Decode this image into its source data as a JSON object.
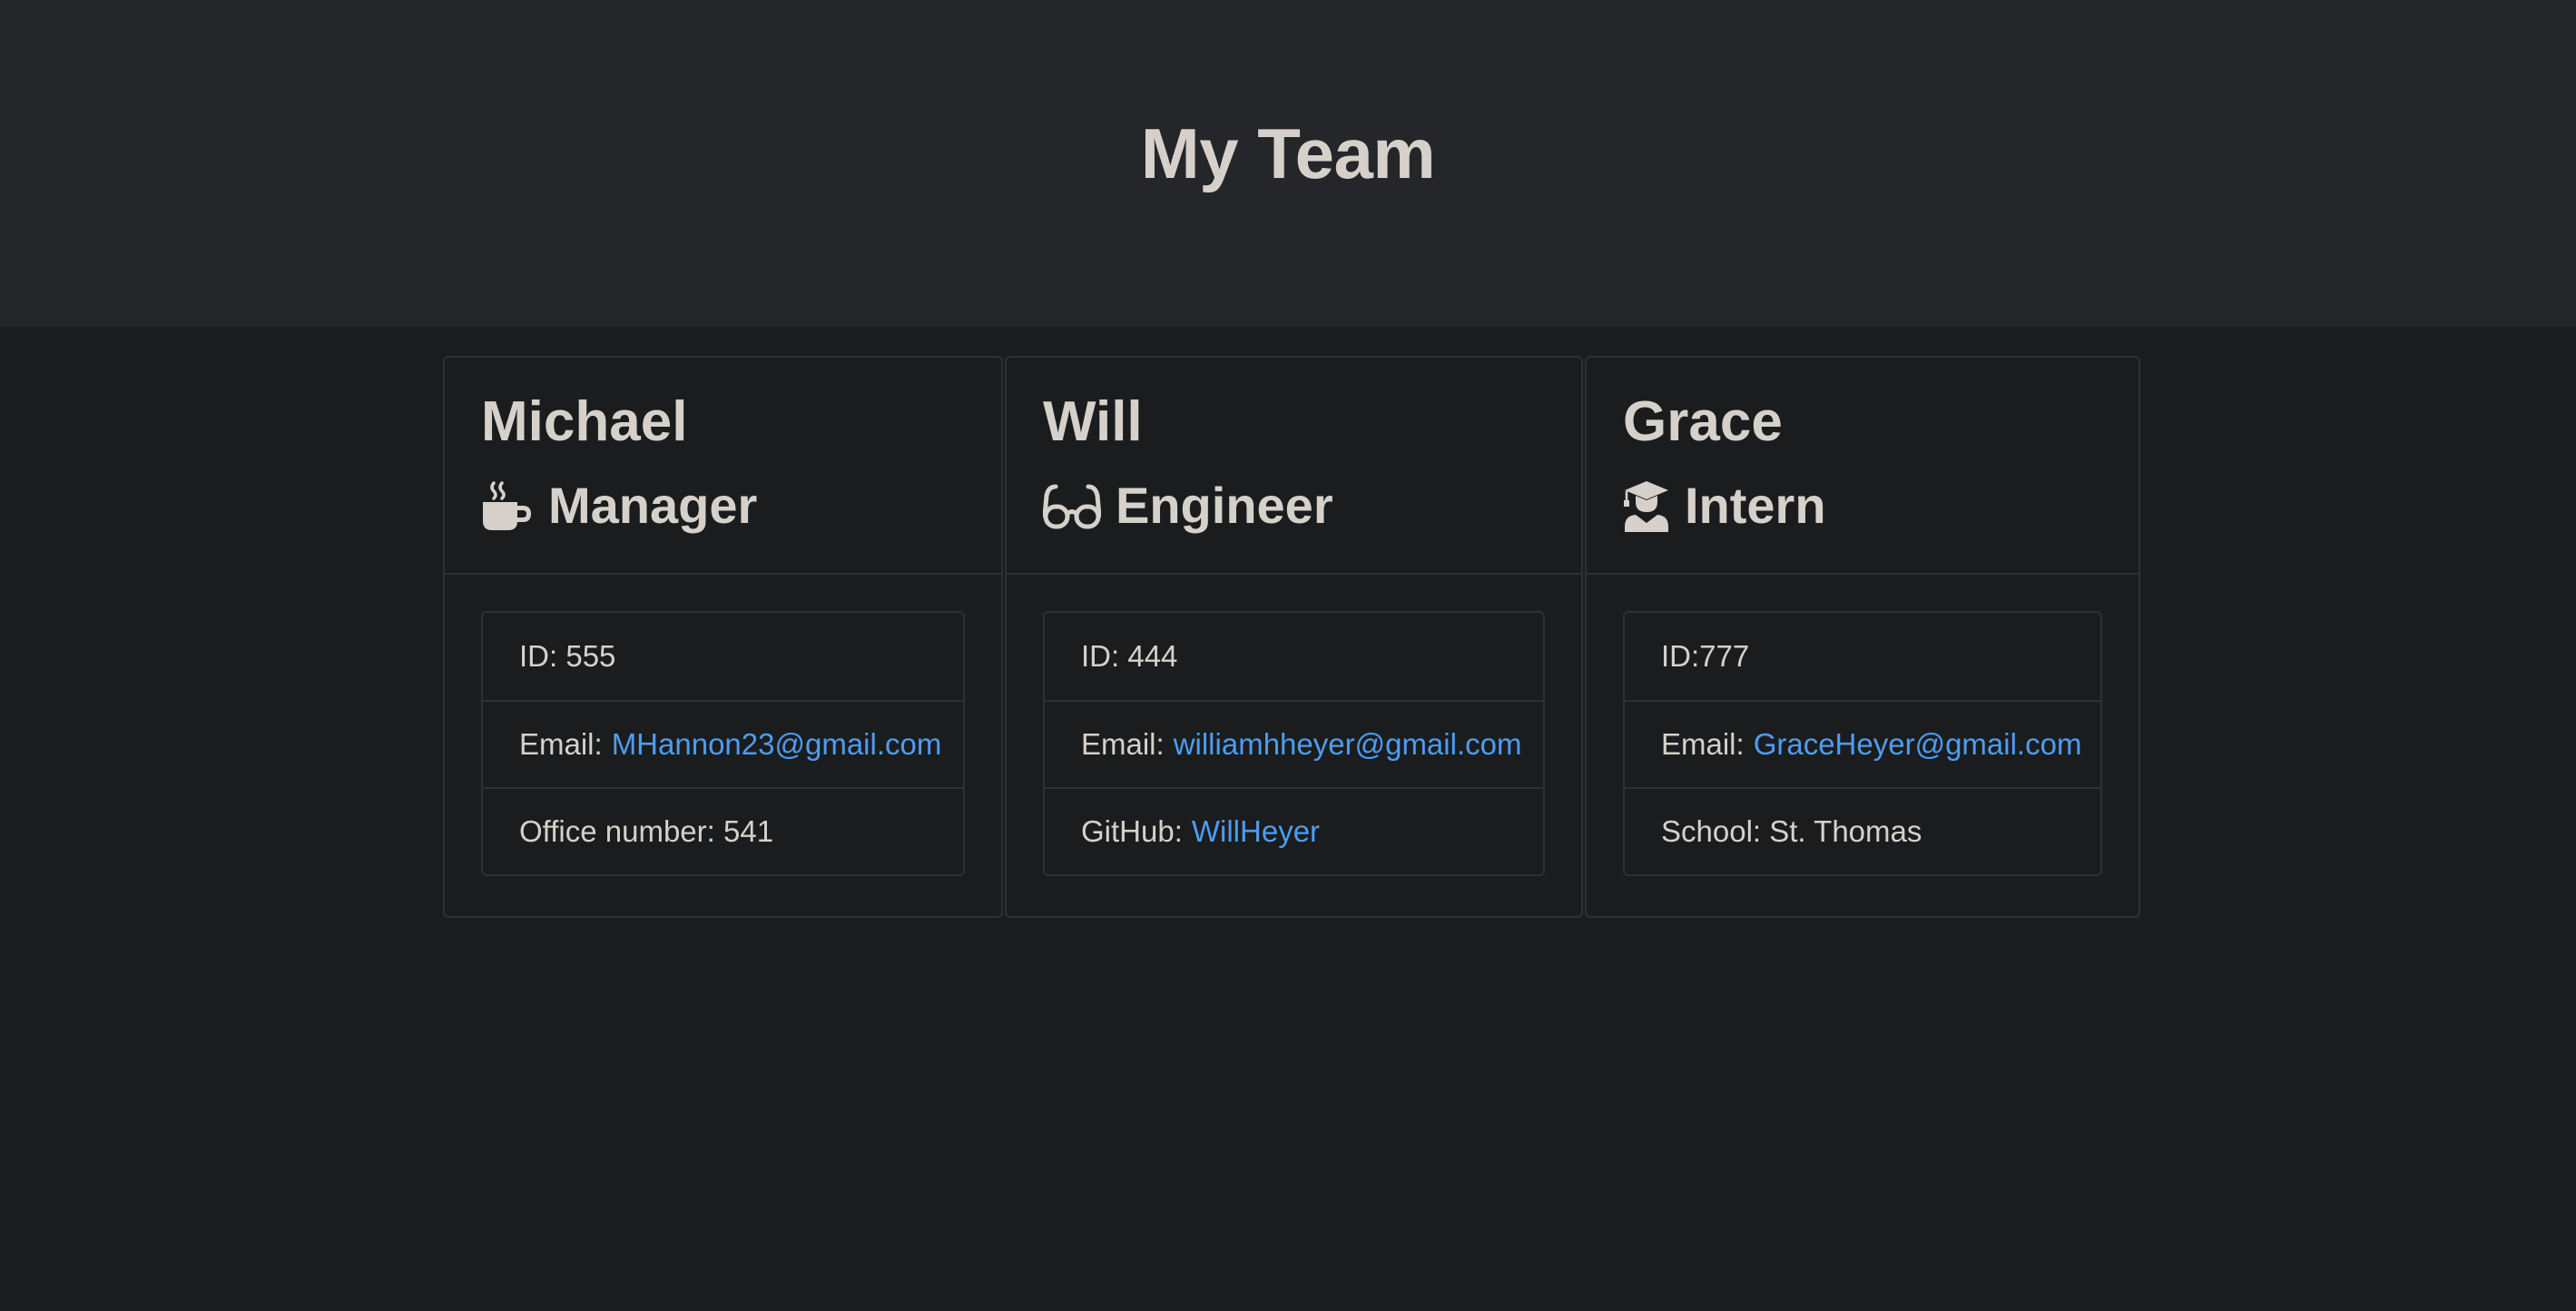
{
  "page_title": "My Team",
  "colors": {
    "header_bg": "#25262a",
    "page_bg": "#1b1c1e",
    "text": "#d5d1ca",
    "link": "#4c9df0",
    "border": "#2f3033"
  },
  "members": [
    {
      "name": "Michael",
      "role": "Manager",
      "icon": "coffee-cup-icon",
      "id_text": "ID: 555",
      "email_label": "Email:",
      "email": "MHannon23@gmail.com",
      "extra_text": "Office number: 541"
    },
    {
      "name": "Will",
      "role": "Engineer",
      "icon": "glasses-icon",
      "id_text": "ID: 444",
      "email_label": "Email:",
      "email": "williamhheyer@gmail.com",
      "extra_label": "GitHub:",
      "extra_link": "WillHeyer"
    },
    {
      "name": "Grace",
      "role": "Intern",
      "icon": "graduate-icon",
      "id_text": "ID:777",
      "email_label": "Email:",
      "email": "GraceHeyer@gmail.com",
      "extra_text": "School: St. Thomas"
    }
  ]
}
